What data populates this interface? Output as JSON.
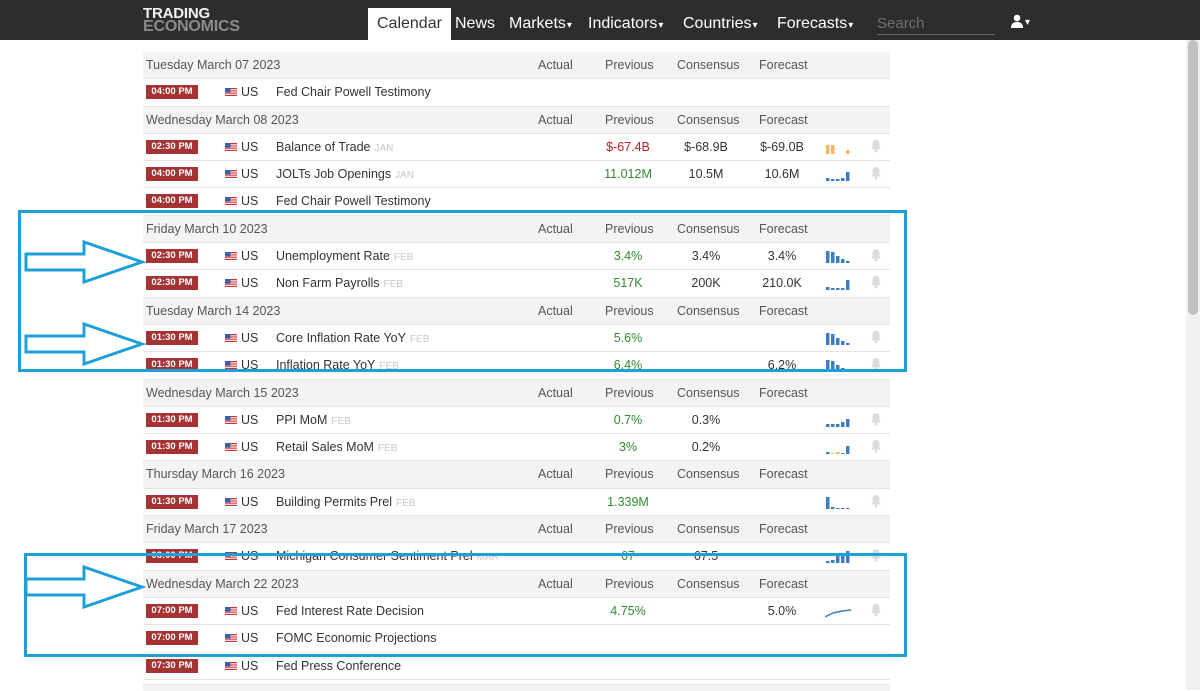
{
  "navbar": {
    "logo_line1": "TRADING",
    "logo_line2": "ECONOMICS",
    "items": [
      {
        "label": "Calendar",
        "active": true
      },
      {
        "label": "News",
        "active": false
      },
      {
        "label": "Markets",
        "caret": "▾",
        "active": false
      },
      {
        "label": "Indicators",
        "caret": "▾",
        "active": false
      },
      {
        "label": "Countries",
        "caret": "▾",
        "active": false
      },
      {
        "label": "Forecasts",
        "caret": "▾",
        "active": false
      }
    ],
    "search_placeholder": "Search",
    "user_caret": "▾"
  },
  "columns": {
    "actual": "Actual",
    "previous": "Previous",
    "consensus": "Consensus",
    "forecast": "Forecast"
  },
  "groups": [
    {
      "date": "Tuesday March 07 2023",
      "events": [
        {
          "time": "04:00 PM",
          "country": "US",
          "event": "Fed Chair Powell Testimony",
          "ref": "",
          "previous": "",
          "consensus": "",
          "forecast": "",
          "spark": "none",
          "bell": false
        }
      ]
    },
    {
      "date": "Wednesday March 08 2023",
      "events": [
        {
          "time": "02:30 PM",
          "country": "US",
          "event": "Balance of Trade",
          "ref": "JAN",
          "previous": "$-67.4B",
          "previous_color": "red",
          "consensus": "$-68.9B",
          "forecast": "$-69.0B",
          "spark": "trade-bars",
          "bell": true
        },
        {
          "time": "04:00 PM",
          "country": "US",
          "event": "JOLTs Job Openings",
          "ref": "JAN",
          "previous": "11.012M",
          "previous_color": "green",
          "consensus": "10.5M",
          "forecast": "10.6M",
          "spark": "jolts-bars",
          "bell": true
        },
        {
          "time": "04:00 PM",
          "country": "US",
          "event": "Fed Chair Powell Testimony",
          "ref": "",
          "previous": "",
          "consensus": "",
          "forecast": "",
          "spark": "none",
          "bell": false
        }
      ]
    },
    {
      "date": "Friday March 10 2023",
      "events": [
        {
          "time": "02:30 PM",
          "country": "US",
          "event": "Unemployment Rate",
          "ref": "FEB",
          "previous": "3.4%",
          "previous_color": "green",
          "consensus": "3.4%",
          "forecast": "3.4%",
          "spark": "descending-bars",
          "bell": true
        },
        {
          "time": "02:30 PM",
          "country": "US",
          "event": "Non Farm Payrolls",
          "ref": "FEB",
          "previous": "517K",
          "previous_color": "green",
          "consensus": "200K",
          "forecast": "210.0K",
          "spark": "payroll-bars",
          "bell": true
        }
      ]
    },
    {
      "date": "Tuesday March 14 2023",
      "events": [
        {
          "time": "01:30 PM",
          "country": "US",
          "event": "Core Inflation Rate YoY",
          "ref": "FEB",
          "previous": "5.6%",
          "previous_color": "green",
          "consensus": "",
          "forecast": "",
          "spark": "descending-bars",
          "bell": true
        },
        {
          "time": "01:30 PM",
          "country": "US",
          "event": "Inflation Rate YoY",
          "ref": "FEB",
          "previous": "6.4%",
          "previous_color": "green",
          "consensus": "",
          "forecast": "6.2%",
          "spark": "descending-bars",
          "bell": true
        }
      ]
    },
    {
      "date": "Wednesday March 15 2023",
      "events": [
        {
          "time": "01:30 PM",
          "country": "US",
          "event": "PPI MoM",
          "ref": "FEB",
          "previous": "0.7%",
          "previous_color": "green",
          "consensus": "0.3%",
          "forecast": "",
          "spark": "small-bars",
          "bell": true
        },
        {
          "time": "01:30 PM",
          "country": "US",
          "event": "Retail Sales MoM",
          "ref": "FEB",
          "previous": "3%",
          "previous_color": "green",
          "consensus": "0.2%",
          "forecast": "",
          "spark": "retail-bars",
          "bell": true
        }
      ]
    },
    {
      "date": "Thursday March 16 2023",
      "events": [
        {
          "time": "01:30 PM",
          "country": "US",
          "event": "Building Permits Prel",
          "ref": "FEB",
          "previous": "1.339M",
          "previous_color": "green",
          "consensus": "",
          "forecast": "",
          "spark": "permit-bars",
          "bell": true
        }
      ]
    },
    {
      "date": "Friday March 17 2023",
      "events": [
        {
          "time": "03:00 PM",
          "country": "US",
          "event": "Michigan Consumer Sentiment Prel",
          "ref": "MAR",
          "previous": "67",
          "previous_color": "green",
          "consensus": "67.5",
          "forecast": "",
          "spark": "rising-bars",
          "bell": true
        }
      ]
    },
    {
      "date": "Wednesday March 22 2023",
      "events": [
        {
          "time": "07:00 PM",
          "country": "US",
          "event": "Fed Interest Rate Decision",
          "ref": "",
          "previous": "4.75%",
          "previous_color": "green",
          "consensus": "",
          "forecast": "5.0%",
          "spark": "rate-line",
          "bell": true
        },
        {
          "time": "07:00 PM",
          "country": "US",
          "event": "FOMC Economic Projections",
          "ref": "",
          "previous": "",
          "consensus": "",
          "forecast": "",
          "spark": "none",
          "bell": false
        },
        {
          "time": "07:30 PM",
          "country": "US",
          "event": "Fed Press Conference",
          "ref": "",
          "previous": "",
          "consensus": "",
          "forecast": "",
          "spark": "none",
          "bell": false
        }
      ]
    }
  ],
  "colors": {
    "time_badge": "#a53333",
    "highlight": "#1e9fd7",
    "spark_blue": "#3d7ebf",
    "spark_orange": "#f5b85c",
    "positive": "#2e8b2e",
    "negative": "#b22222"
  },
  "icons": [
    "user-icon",
    "us-flag-icon",
    "bell-icon",
    "arrow-icon",
    "sparkline-icon"
  ]
}
